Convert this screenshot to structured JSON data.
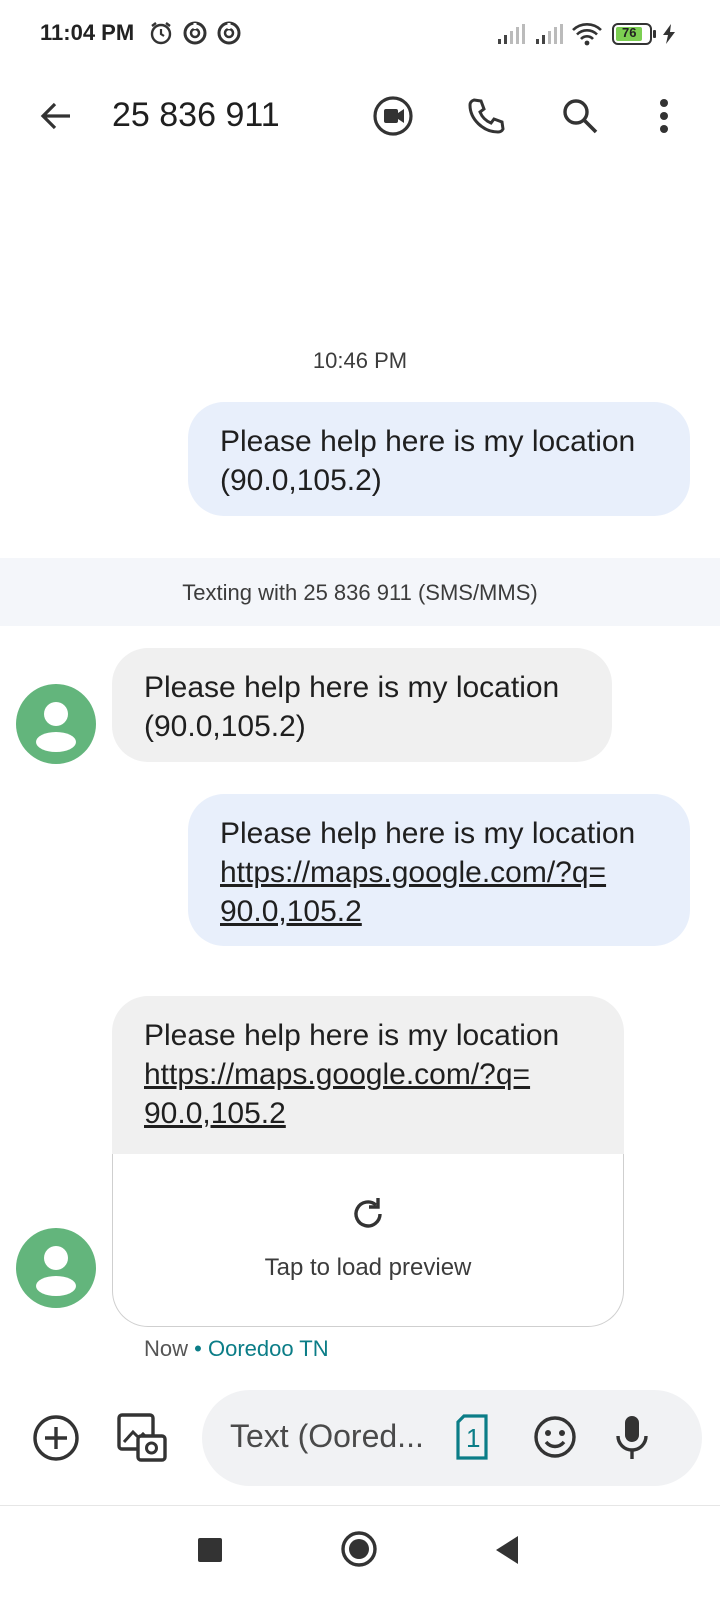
{
  "status_bar": {
    "time": "11:04 PM",
    "battery": "76",
    "icons": [
      "alarm-icon",
      "data-saver-icon",
      "data-saver-icon",
      "signal-icon",
      "signal-icon",
      "wifi-icon",
      "battery-icon",
      "charging-icon"
    ]
  },
  "app_bar": {
    "title": "25 836 911",
    "icons": [
      "back-arrow-icon",
      "video-call-icon",
      "phone-icon",
      "search-icon",
      "more-vert-icon"
    ]
  },
  "conversation": {
    "timestamp": "10:46 PM",
    "info_band": "Texting with 25 836 911 (SMS/MMS)",
    "messages": [
      {
        "direction": "outgoing",
        "line1": "Please help here is my location",
        "line2": "(90.0,105.2)"
      },
      {
        "direction": "incoming",
        "line1": "Please help here is my location",
        "line2": "(90.0,105.2)"
      },
      {
        "direction": "outgoing",
        "line1": "Please help here is my location",
        "link1": "https://maps.google.com/?q=",
        "link2": "90.0,105.2"
      },
      {
        "direction": "incoming",
        "line1": "Please help here is my location",
        "link1": "https://maps.google.com/?q=",
        "link2": "90.0,105.2"
      }
    ],
    "preview": {
      "label": "Tap to load preview"
    },
    "meta": {
      "time": "Now",
      "separator": "•",
      "carrier": "Ooredoo TN"
    }
  },
  "composer": {
    "placeholder": "Text (Oored...",
    "sim": "1",
    "icons": [
      "add-circle-icon",
      "gallery-icon",
      "sim-icon",
      "emoji-icon",
      "mic-icon"
    ]
  },
  "colors": {
    "outgoing_bubble": "#e8effb",
    "incoming_bubble": "#f0f0f0",
    "avatar": "#63b57c",
    "accent": "#0b7d87"
  }
}
